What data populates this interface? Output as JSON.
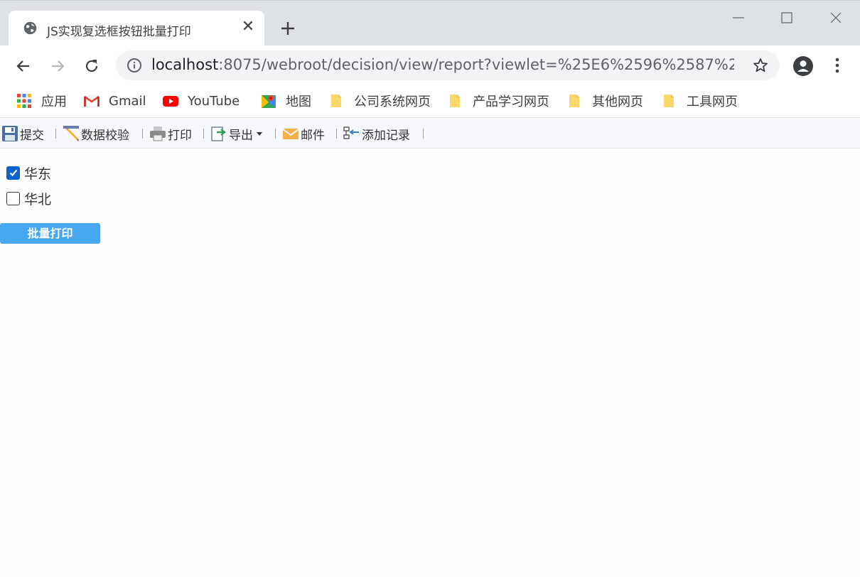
{
  "browser": {
    "tab_title": "JS实现复选框按钮批量打印",
    "url_host": "localhost",
    "url_rest": ":8075/webroot/decision/view/report?viewlet=%25E6%2596%2587%25..."
  },
  "bookmarks": [
    {
      "label": "应用",
      "icon": "apps-grid-icon"
    },
    {
      "label": "Gmail",
      "icon": "gmail-icon"
    },
    {
      "label": "YouTube",
      "icon": "youtube-icon"
    },
    {
      "label": "地图",
      "icon": "maps-icon"
    },
    {
      "label": "公司系统网页",
      "icon": "folder-icon"
    },
    {
      "label": "产品学习网页",
      "icon": "folder-icon"
    },
    {
      "label": "其他网页",
      "icon": "folder-icon"
    },
    {
      "label": "工具网页",
      "icon": "folder-icon"
    }
  ],
  "toolbar": {
    "submit": "提交",
    "validate": "数据校验",
    "print": "打印",
    "export": "导出",
    "email": "邮件",
    "add_record": "添加记录"
  },
  "checkboxes": [
    {
      "label": "华东",
      "checked": true
    },
    {
      "label": "华北",
      "checked": false
    }
  ],
  "batch_print_label": "批量打印",
  "colors": {
    "accent": "#47a7f0",
    "checkbox_checked": "#0b63ce",
    "toolbar_bg": "#f6f8fb"
  }
}
